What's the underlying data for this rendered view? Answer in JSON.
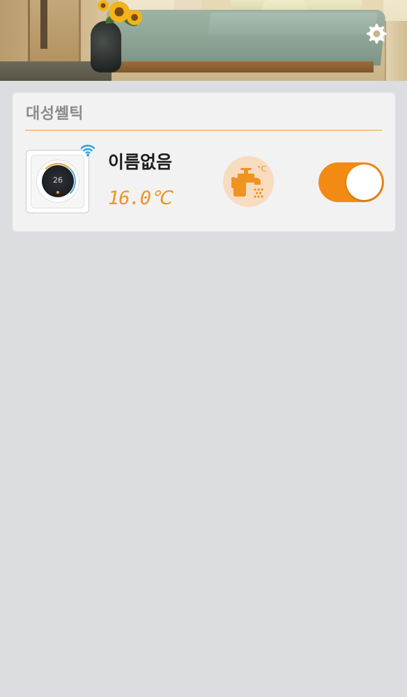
{
  "header": {
    "settings_icon": "gear-icon"
  },
  "group": {
    "title": "대성쎌틱",
    "divider_color": "#f2c58a"
  },
  "device": {
    "name": "이름없음",
    "temperature": "16.0℃",
    "thumbnail_display": "26",
    "wifi_icon": "wifi-icon",
    "hot_water_icon": "hot-water-faucet-icon",
    "power_on": true,
    "accent_color": "#f38a13"
  }
}
